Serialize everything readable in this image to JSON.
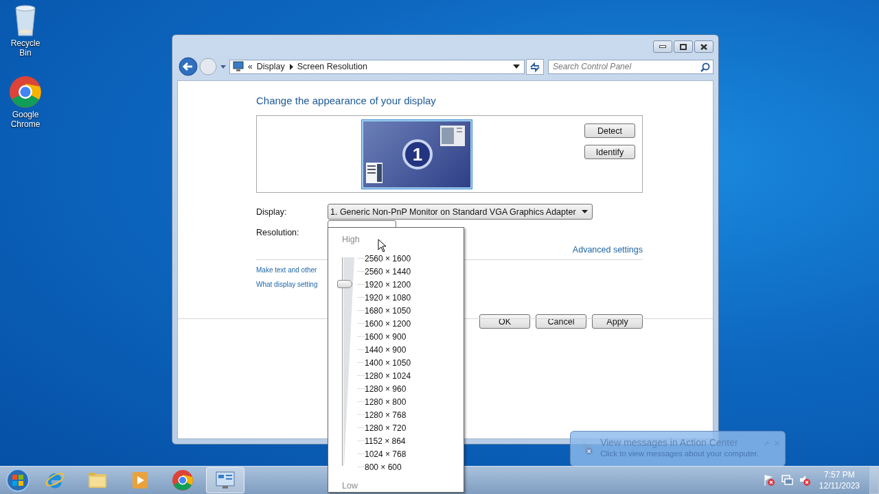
{
  "desktop_icons": [
    {
      "kind": "recycle_bin",
      "label": "Recycle Bin"
    },
    {
      "kind": "chrome",
      "label": "Google Chrome"
    }
  ],
  "window": {
    "address_bar": {
      "overflow": "«",
      "breadcrumbs": [
        "Display",
        "Screen Resolution"
      ]
    },
    "search": {
      "placeholder": "Search Control Panel"
    },
    "heading": "Change the appearance of your display",
    "monitor": {
      "number": "1",
      "selected": true
    },
    "side_buttons": [
      "Detect",
      "Identify"
    ],
    "display_field": {
      "label": "Display:",
      "value": "1. Generic Non-PnP Monitor on Standard VGA Graphics Adapter"
    },
    "resolution_field": {
      "label": "Resolution:"
    },
    "advanced_link": "Advanced settings",
    "links": [
      "Make text and other",
      "What display setting"
    ],
    "buttons": [
      "OK",
      "Cancel",
      "Apply"
    ]
  },
  "resolution_popup": {
    "high_label": "High",
    "low_label": "Low",
    "slider": {
      "level": 0.875
    },
    "options": [
      "2560 × 1600",
      "2560 × 1440",
      "1920 × 1200",
      "1920 × 1080",
      "1680 × 1050",
      "1600 × 1200",
      "1600 × 900",
      "1440 × 900",
      "1400 × 1050",
      "1280 × 1024",
      "1280 × 960",
      "1280 × 800",
      "1280 × 768",
      "1280 × 720",
      "1152 × 864",
      "1024 × 768",
      "800 × 600"
    ]
  },
  "notification": {
    "title": "View messages in Action Center",
    "message": "Click to view messages about your computer."
  },
  "taskbar": {
    "apps": [
      {
        "kind": "browser_e",
        "active": false
      },
      {
        "kind": "folder",
        "active": false
      },
      {
        "kind": "media",
        "active": false
      },
      {
        "kind": "chrome",
        "active": false
      },
      {
        "kind": "control_panel",
        "active": true
      }
    ],
    "clock": {
      "time": "7:57 PM",
      "date": "12/11/2023"
    }
  }
}
